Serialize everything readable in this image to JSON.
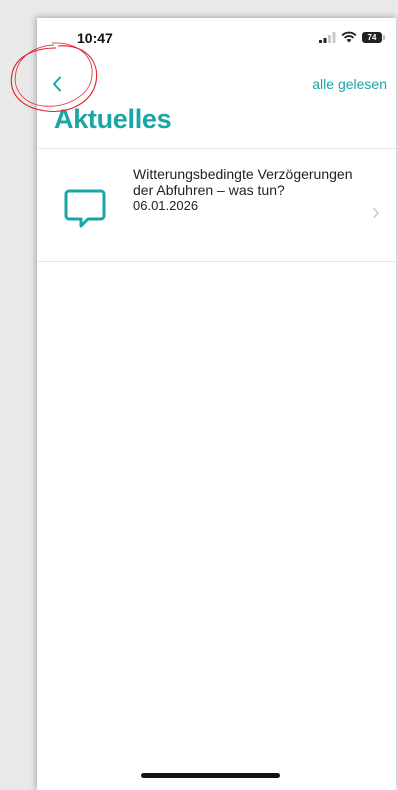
{
  "status_bar": {
    "time": "10:47",
    "battery_level": "74"
  },
  "nav": {
    "back_icon": "chevron-left-icon",
    "mark_all_read_label": "alle gelesen"
  },
  "page": {
    "title": "Aktuelles"
  },
  "news_items": [
    {
      "icon": "speech-bubble-icon",
      "title": "Witterungsbedingte Verzögerungen der Abfuhren – was tun?",
      "date": "06.01.2026"
    }
  ],
  "colors": {
    "accent": "#1aa6a5",
    "annotation": "#e0202a"
  }
}
